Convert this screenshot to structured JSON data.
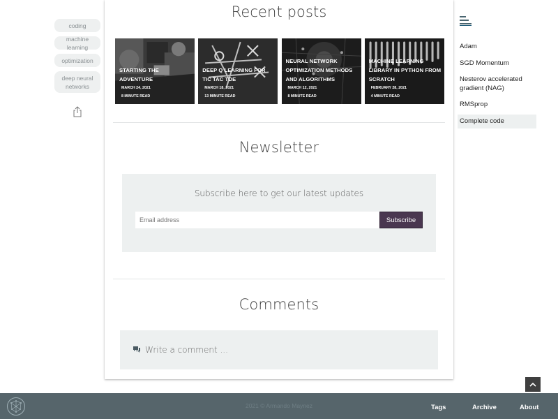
{
  "tags": [
    "coding",
    "machine learning",
    "optimization",
    "deep neural networks"
  ],
  "recent_posts": {
    "title": "Recent posts",
    "posts": [
      {
        "title": "STARTING THE ADVENTURE",
        "date": "MARCH 24, 2021",
        "read_time": "8 MINUTE READ"
      },
      {
        "title": "DEEP Q LEARNING FOR TIC TAC TOE",
        "date": "MARCH 18, 2021",
        "read_time": "13 MINUTE READ"
      },
      {
        "title": "NEURAL NETWORK OPTIMIZATION METHODS AND ALGORITHMS",
        "date": "MARCH 12, 2021",
        "read_time": "8 MINUTE READ"
      },
      {
        "title": "MACHINE LEARNING LIBRARY IN PYTHON FROM SCRATCH",
        "date": "FEBRUARY 28, 2021",
        "read_time": "4 MINUTE READ"
      }
    ]
  },
  "newsletter": {
    "title": "Newsletter",
    "description": "Subscribe here to get our latest updates",
    "email_placeholder": "Email address",
    "subscribe_label": "Subscribe"
  },
  "comments": {
    "title": "Comments",
    "placeholder": "Write a comment ..."
  },
  "toc": {
    "items": [
      "Adam",
      "SGD Momentum",
      "Nesterov accelerated gradient (NAG)",
      "RMSprop",
      "Complete code"
    ],
    "active_index": 4
  },
  "footer": {
    "copyright": "2021 © Armando Maynez",
    "links": [
      "Tags",
      "Archive",
      "About"
    ]
  },
  "colors": {
    "accent": "#4a3750",
    "footer_bg": "#56656b",
    "panel_bg": "#edf0f0"
  }
}
